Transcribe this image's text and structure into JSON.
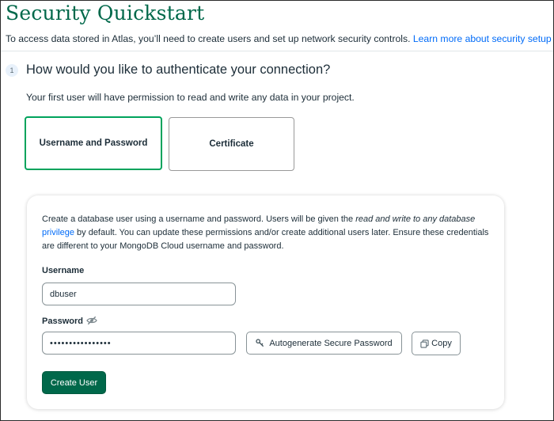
{
  "page": {
    "title": "Security Quickstart",
    "intro_text": "To access data stored in Atlas, you’ll need to create users and set up network security controls. ",
    "intro_link": "Learn more about security setup"
  },
  "step": {
    "number": "1",
    "title": "How would you like to authenticate your connection?",
    "description": "Your first user will have permission to read and write any data in your project."
  },
  "auth_options": {
    "username_password": "Username and Password",
    "certificate": "Certificate",
    "selected": "Username and Password"
  },
  "form": {
    "desc_part1": "Create a database user using a username and password. Users will be given the ",
    "desc_italic": "read and write to any database",
    "desc_link": "privilege",
    "desc_part2": " by default. You can update these permissions and/or create additional users later. Ensure these credentials are different to your MongoDB Cloud username and password.",
    "username_label": "Username",
    "username_value": "dbuser",
    "password_label": "Password",
    "password_value": "••••••••••••••••",
    "autogenerate_label": "Autogenerate Secure Password",
    "copy_label": "Copy",
    "create_user_label": "Create User"
  },
  "colors": {
    "brand_green": "#00684a",
    "selected_border": "#00a35c",
    "link_blue": "#016bf8"
  },
  "icons": {
    "password_visibility": "eye-slash-icon",
    "autogenerate": "key-icon",
    "copy": "copy-icon"
  }
}
